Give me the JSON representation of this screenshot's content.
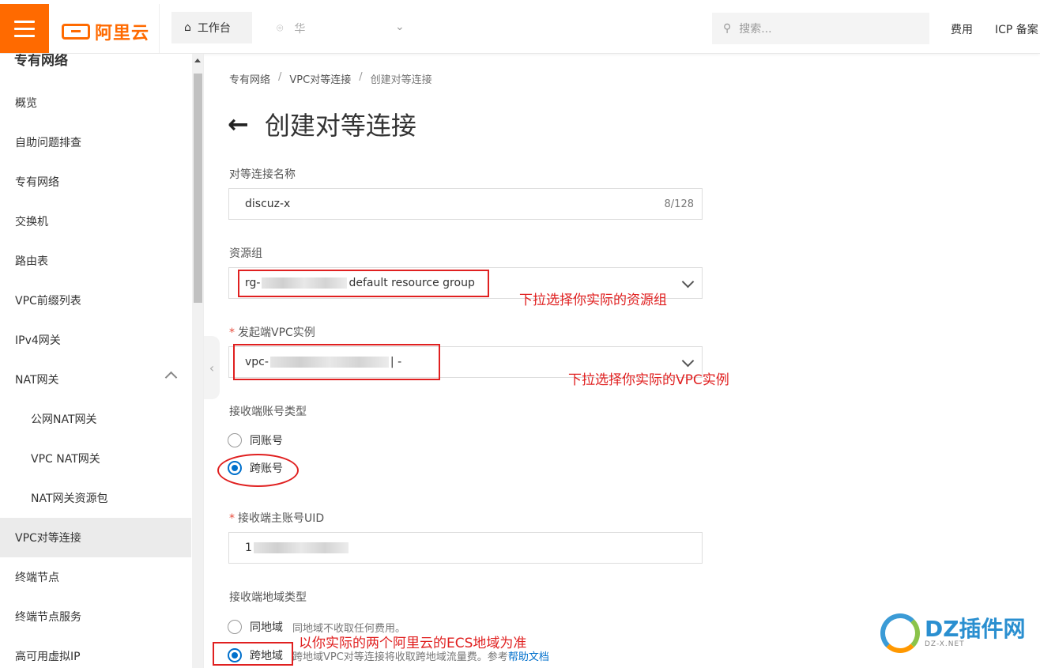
{
  "topbar": {
    "brand": "阿里云",
    "workbench": "工作台",
    "region": "华",
    "search_placeholder": "搜索...",
    "links": [
      "费用",
      "ICP 备案"
    ]
  },
  "sidebar": {
    "title": "专有网络",
    "items": [
      {
        "label": "概览"
      },
      {
        "label": "自助问题排查"
      },
      {
        "label": "专有网络"
      },
      {
        "label": "交换机"
      },
      {
        "label": "路由表"
      },
      {
        "label": "VPC前缀列表"
      },
      {
        "label": "IPv4网关"
      },
      {
        "label": "NAT网关"
      },
      {
        "label": "公网NAT网关"
      },
      {
        "label": "VPC NAT网关"
      },
      {
        "label": "NAT网关资源包"
      },
      {
        "label": "VPC对等连接"
      },
      {
        "label": "终端节点"
      },
      {
        "label": "终端节点服务"
      },
      {
        "label": "高可用虚拟IP"
      }
    ]
  },
  "breadcrumb": [
    "专有网络",
    "VPC对等连接",
    "创建对等连接"
  ],
  "page_title": "创建对等连接",
  "form": {
    "name": {
      "label": "对等连接名称",
      "value": "discuz-x",
      "counter": "8/128"
    },
    "resource_group": {
      "label": "资源组",
      "prefix": "rg-",
      "value": "default resource group"
    },
    "vpc": {
      "required_mark": "*",
      "label": "发起端VPC实例",
      "prefix": "vpc-",
      "suffix": "| -"
    },
    "account_type": {
      "label": "接收端账号类型",
      "options": [
        "同账号",
        "跨账号"
      ],
      "selected": "跨账号"
    },
    "uid": {
      "required_mark": "*",
      "label": "接收端主账号UID",
      "value": "1"
    },
    "region_type": {
      "label": "接收端地域类型",
      "options": [
        {
          "label": "同地域",
          "hint": "同地域不收取任何费用。"
        },
        {
          "label": "跨地域",
          "hint": "跨地域VPC对等连接将收取跨地域流量费。参考",
          "link": "帮助文档"
        }
      ],
      "selected": "跨地域"
    }
  },
  "annotations": {
    "resource_group": "下拉选择你实际的资源组",
    "vpc": "下拉选择你实际的VPC实例",
    "region": "以你实际的两个阿里云的ECS地域为准"
  },
  "watermark": {
    "text": "DZ插件网",
    "sub": "DZ-X.NET"
  },
  "colors": {
    "brand": "#ff6a00",
    "accent": "#0070cc",
    "annotation": "#e02020"
  }
}
